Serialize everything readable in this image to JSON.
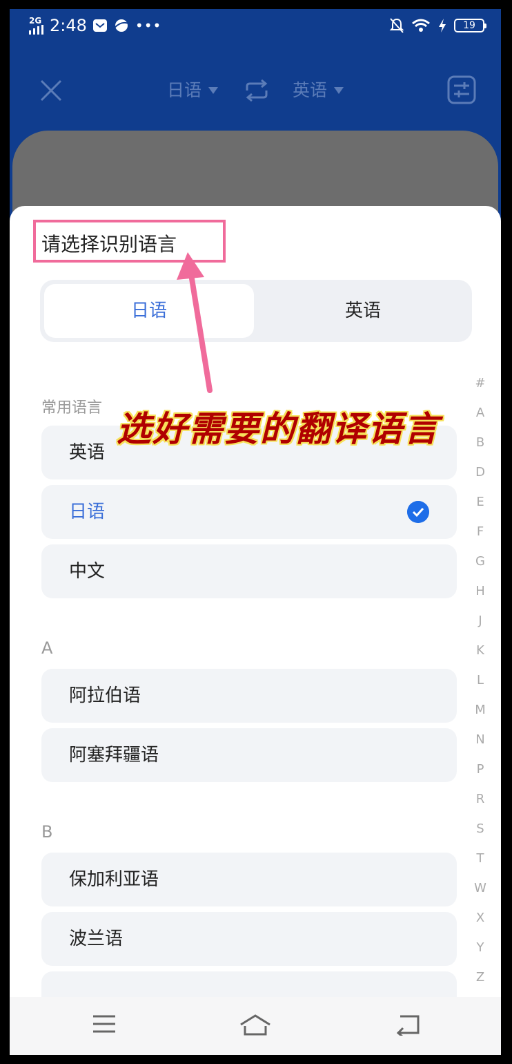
{
  "status_bar": {
    "network": "2G",
    "time": "2:48",
    "battery": "19"
  },
  "header": {
    "source_lang": "日语",
    "target_lang": "英语"
  },
  "sheet": {
    "title": "请选择识别语言",
    "segments": {
      "source": "日语",
      "target": "英语"
    },
    "common_label": "常用语言",
    "common": [
      {
        "label": "英语"
      },
      {
        "label": "日语"
      },
      {
        "label": "中文"
      }
    ],
    "groups": [
      {
        "letter": "A",
        "items": [
          {
            "label": "阿拉伯语"
          },
          {
            "label": "阿塞拜疆语"
          }
        ]
      },
      {
        "letter": "B",
        "items": [
          {
            "label": "保加利亚语"
          },
          {
            "label": "波兰语"
          }
        ]
      }
    ],
    "index": [
      "#",
      "A",
      "B",
      "D",
      "E",
      "F",
      "G",
      "H",
      "J",
      "K",
      "L",
      "M",
      "N",
      "P",
      "R",
      "S",
      "T",
      "W",
      "X",
      "Y",
      "Z"
    ]
  },
  "annotation": {
    "callout": "选好需要的翻译语言"
  },
  "colors": {
    "accent": "#3a6ed8",
    "check": "#1e6de8",
    "highlight": "#f06b9b",
    "callout_text": "#b00000",
    "callout_outline": "#f7e15a"
  }
}
